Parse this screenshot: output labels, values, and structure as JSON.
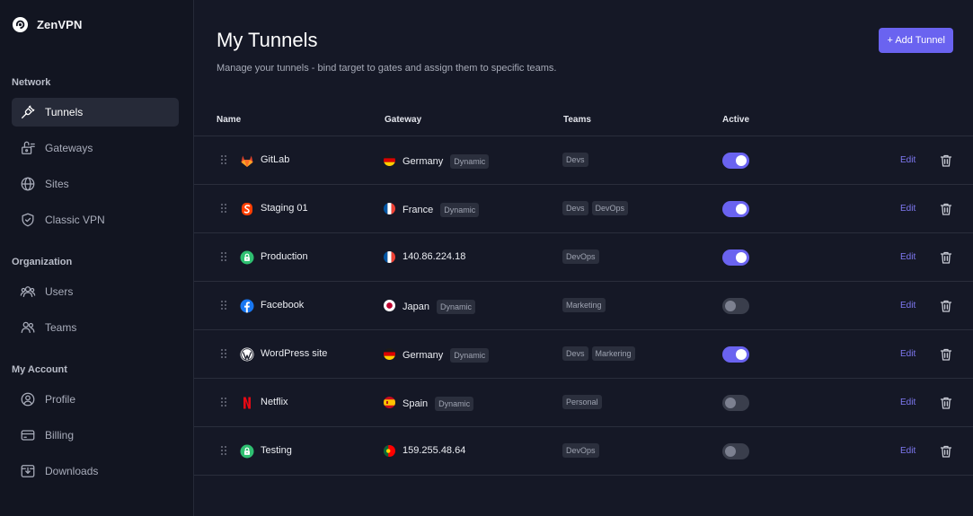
{
  "brand": {
    "name": "ZenVPN"
  },
  "sidebar": {
    "sections": [
      {
        "title": "Network"
      },
      {
        "title": "Organization"
      },
      {
        "title": "My Account"
      }
    ],
    "items": [
      {
        "label": "Tunnels",
        "icon": "plug-icon"
      },
      {
        "label": "Gateways",
        "icon": "gateway-icon"
      },
      {
        "label": "Sites",
        "icon": "globe-icon"
      },
      {
        "label": "Classic VPN",
        "icon": "shield-icon"
      },
      {
        "label": "Users",
        "icon": "users-icon"
      },
      {
        "label": "Teams",
        "icon": "team-icon"
      },
      {
        "label": "Profile",
        "icon": "profile-icon"
      },
      {
        "label": "Billing",
        "icon": "card-icon"
      },
      {
        "label": "Downloads",
        "icon": "download-icon"
      }
    ]
  },
  "header": {
    "title": "My Tunnels",
    "subtitle": "Manage your tunnels - bind target to gates and assign them to specific teams.",
    "add_label": "+ Add Tunnel"
  },
  "table": {
    "columns": {
      "name": "Name",
      "gateway": "Gateway",
      "teams": "Teams",
      "active": "Active"
    },
    "edit_label": "Edit",
    "rows": [
      {
        "name": "GitLab",
        "icon": "gitlab-icon",
        "flag": "germany-flag",
        "gateway": "Germany",
        "badge": "Dynamic",
        "teams": [
          "Devs"
        ],
        "active": true
      },
      {
        "name": "Staging 01",
        "icon": "svelte-icon",
        "flag": "france-flag",
        "gateway": "France",
        "badge": "Dynamic",
        "teams": [
          "Devs",
          "DevOps"
        ],
        "active": true
      },
      {
        "name": "Production",
        "icon": "lock-icon",
        "flag": "france-flag",
        "gateway": "140.86.224.18",
        "badge": "",
        "teams": [
          "DevOps"
        ],
        "active": true
      },
      {
        "name": "Facebook",
        "icon": "facebook-icon",
        "flag": "japan-flag",
        "gateway": "Japan",
        "badge": "Dynamic",
        "teams": [
          "Marketing"
        ],
        "active": false
      },
      {
        "name": "WordPress site",
        "icon": "wordpress-icon",
        "flag": "germany-flag",
        "gateway": "Germany",
        "badge": "Dynamic",
        "teams": [
          "Devs",
          "Markering"
        ],
        "active": true
      },
      {
        "name": "Netflix",
        "icon": "netflix-icon",
        "flag": "spain-flag",
        "gateway": "Spain",
        "badge": "Dynamic",
        "teams": [
          "Personal"
        ],
        "active": false
      },
      {
        "name": "Testing",
        "icon": "lock-icon",
        "flag": "portugal-flag",
        "gateway": "159.255.48.64",
        "badge": "",
        "teams": [
          "DevOps"
        ],
        "active": false
      }
    ]
  },
  "colors": {
    "background": "#151826",
    "sidebar": "#121521",
    "accent": "#6a63f0",
    "border": "#2a2e3c",
    "badge": "#2b2f3d"
  }
}
